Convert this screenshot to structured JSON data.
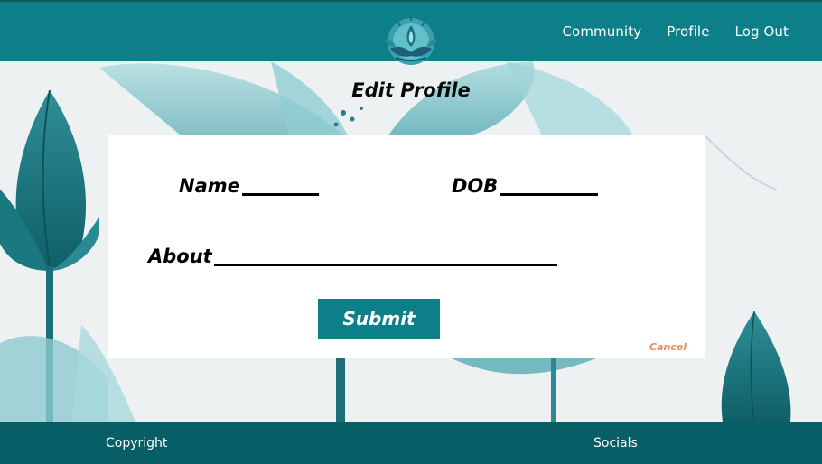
{
  "header": {
    "nav": {
      "community": "Community",
      "profile": "Profile",
      "logout": "Log Out"
    },
    "logo_icon": "lotus-meditation-logo"
  },
  "main": {
    "title": "Edit Profile",
    "form": {
      "name_label": "Name",
      "dob_label": "DOB",
      "about_label": "About",
      "submit_label": "Submit",
      "cancel_label": "Cancel"
    }
  },
  "footer": {
    "copyright": "Copyright",
    "socials": "Socials"
  },
  "colors": {
    "primary": "#0d7f88",
    "footer": "#075e66",
    "cancel": "#f08a62"
  }
}
